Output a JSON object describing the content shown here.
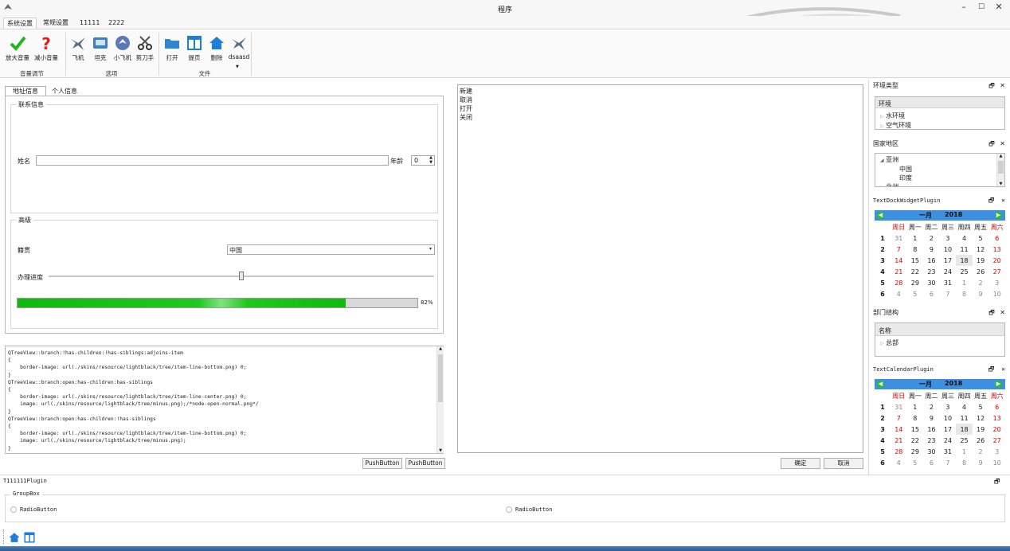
{
  "window": {
    "title": "程序",
    "minimize": "–",
    "maximize": "☐",
    "close": "✕"
  },
  "ribbon_tabs": [
    "系统设置",
    "常规设置",
    "11111",
    "2222"
  ],
  "ribbon_groups": [
    {
      "label": "音量调节",
      "buttons": [
        "放大音量",
        "减小音量"
      ]
    },
    {
      "label": "选项",
      "buttons": [
        "飞机",
        "坦克",
        "小飞机",
        "剪刀手"
      ]
    },
    {
      "label": "文件",
      "buttons": [
        "打开",
        "提页",
        "删除",
        "dsaasd"
      ]
    }
  ],
  "form": {
    "tabs": [
      "地址信息",
      "个人信息"
    ],
    "contact_group": "联系信息",
    "name_label": "姓名",
    "name_value": "",
    "age_label": "年龄",
    "age_value": "0",
    "advanced_group": "高级",
    "origin_label": "籍贯",
    "origin_value": "中国",
    "progress_label": "办理进度",
    "slider_fraction": 0.5,
    "progress_value": 82,
    "progress_text": "82%"
  },
  "code_editor": {
    "lines": [
      "QTreeView::branch:!has-children:!has-siblings:adjoins-item",
      "{",
      "    border-image: url(./skins/resource/lightblack/tree/item-line-bottom.png) 0;",
      "}",
      "QTreeView::branch:open:has-children:has-siblings",
      "{",
      "    border-image: url(./skins/resource/lightblack/tree/item-line-center.png) 0;",
      "    image: url(./skins/resource/lightblack/tree/minus.png);/*node-open-normal.png*/",
      "}",
      "QTreeView::branch:open:has-children:!has-siblings",
      "{",
      "    border-image: url(./skins/resource/lightblack/tree/item-line-bottom.png) 0;",
      "    image: url(./skins/resource/lightblack/tree/minus.png);",
      "}"
    ],
    "button1": "PushButton",
    "button2": "PushButton"
  },
  "list_panel": {
    "items": [
      "新建",
      "取消",
      "打开",
      "关闭"
    ],
    "ok": "确定",
    "cancel": "取消"
  },
  "docks": {
    "env_title": "环境类型",
    "env_header": "环境",
    "env_items": [
      "水环境",
      "空气环境"
    ],
    "region_title": "国家地区",
    "region_items": [
      "亚洲",
      "中国",
      "印度",
      "北洲"
    ],
    "text_dock_title": "TextDockWidgetPlugin",
    "dept_title": "部门结构",
    "dept_header": "名称",
    "dept_items": [
      "总部"
    ],
    "text_cal_title": "TextCalendarPlugin",
    "dock_controls": "🗗 ✕"
  },
  "calendar": {
    "month": "一月",
    "year": "2018",
    "weekdays": [
      "周日",
      "周一",
      "周二",
      "周三",
      "周四",
      "周五",
      "周六"
    ],
    "weeks": [
      {
        "wk": "1",
        "days": [
          "31",
          "1",
          "2",
          "3",
          "4",
          "5",
          "6"
        ]
      },
      {
        "wk": "2",
        "days": [
          "7",
          "8",
          "9",
          "10",
          "11",
          "12",
          "13"
        ]
      },
      {
        "wk": "3",
        "days": [
          "14",
          "15",
          "16",
          "17",
          "18",
          "19",
          "20"
        ]
      },
      {
        "wk": "4",
        "days": [
          "21",
          "22",
          "23",
          "24",
          "25",
          "26",
          "27"
        ]
      },
      {
        "wk": "5",
        "days": [
          "28",
          "29",
          "30",
          "31",
          "1",
          "2",
          "3"
        ]
      },
      {
        "wk": "6",
        "days": [
          "4",
          "5",
          "6",
          "7",
          "8",
          "9",
          "10"
        ]
      }
    ],
    "today": "18"
  },
  "bottom_dock": {
    "title": "T111111Plugin",
    "groupbox": "GroupBox",
    "radio1": "RadioButton",
    "radio2": "RadioButton"
  },
  "colors": {
    "progress": "#1fc71f",
    "calendar_header": "#3d8fe0",
    "weekend": "#e00000",
    "accent_icon": "#1e7fd8"
  }
}
